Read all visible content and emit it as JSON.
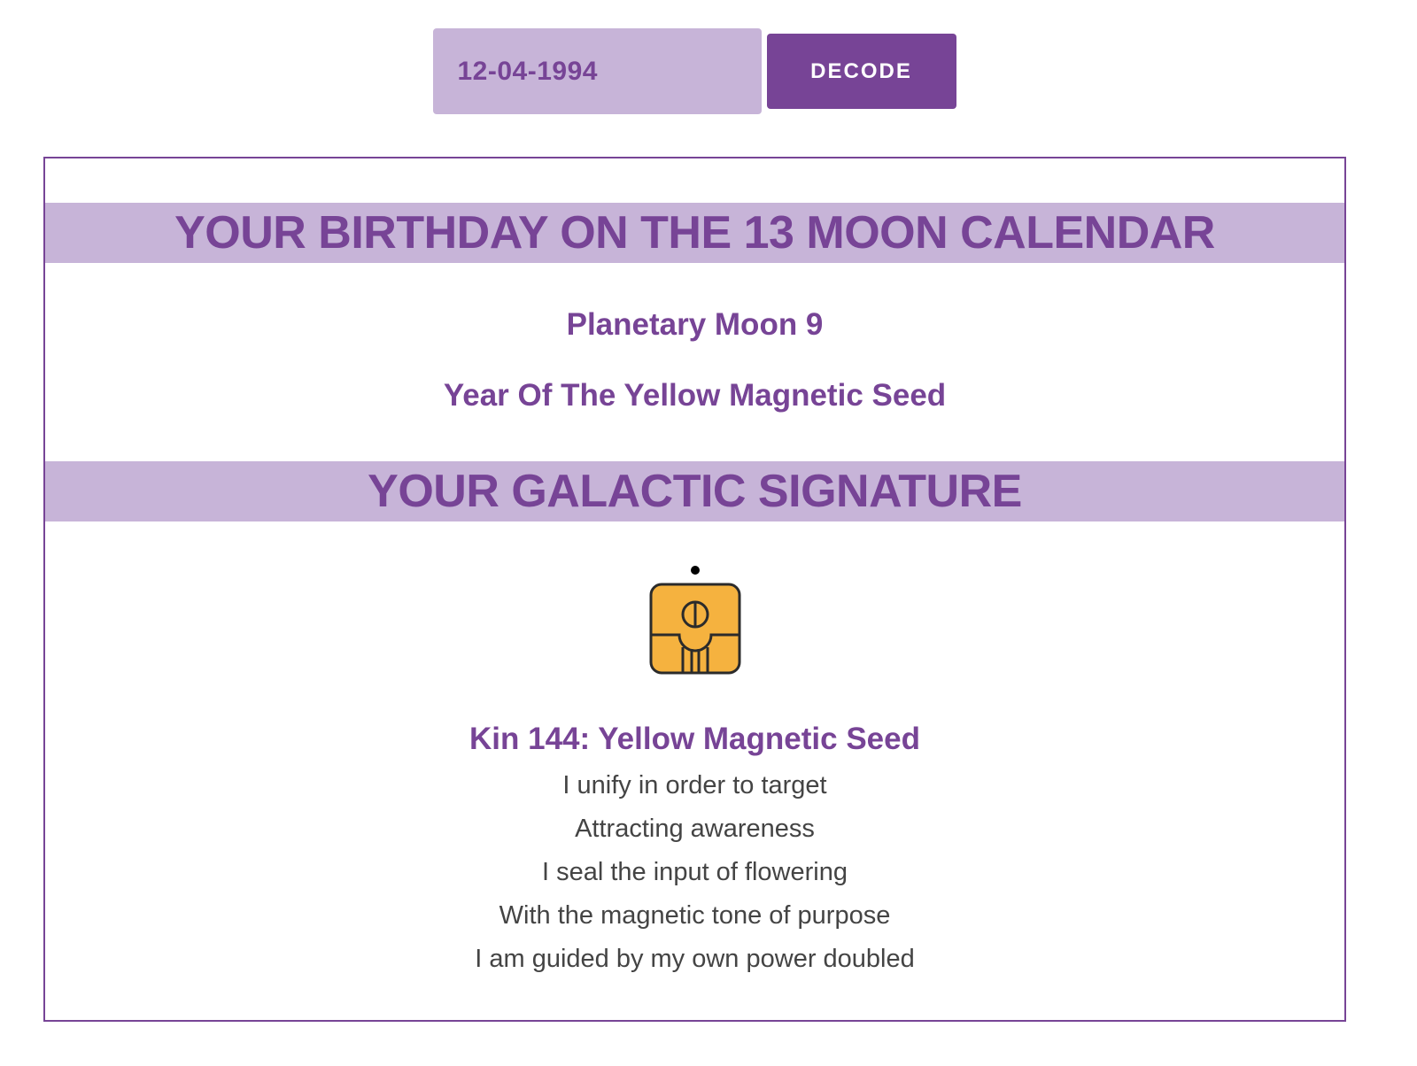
{
  "form": {
    "date_value": "12-04-1994",
    "decode_label": "DECODE"
  },
  "calendar": {
    "heading": "YOUR BIRTHDAY ON THE 13 MOON CALENDAR",
    "moon": "Planetary Moon 9",
    "year": "Year Of The Yellow Magnetic Seed"
  },
  "signature": {
    "heading": "YOUR GALACTIC SIGNATURE",
    "glyph_icon": "yellow-seed-glyph-icon",
    "tone_dots": 1,
    "glyph_color": "#f5b23f",
    "kin_title": "Kin 144: Yellow Magnetic Seed",
    "affirmation": [
      "I unify in order to target",
      "Attracting awareness",
      "I seal the input of flowering",
      "With the magnetic tone of purpose",
      "I am guided by my own power doubled"
    ]
  },
  "colors": {
    "brand_purple": "#774496",
    "light_purple": "#c7b4d8",
    "text_gray": "#444444"
  }
}
